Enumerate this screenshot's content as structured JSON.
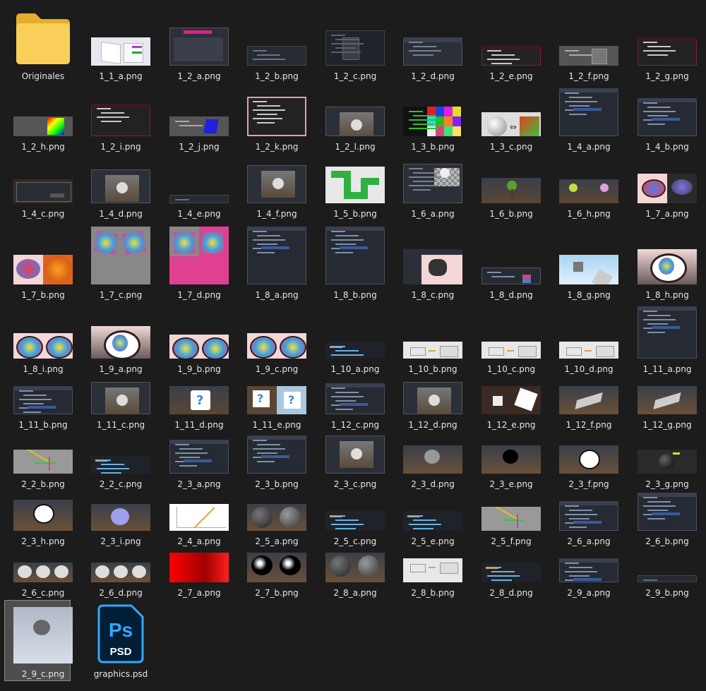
{
  "items": [
    {
      "name": "Originales",
      "kind": "folder"
    },
    {
      "name": "1_1_a.png",
      "kind": "white-diagram"
    },
    {
      "name": "1_2_a.png",
      "kind": "editor-magenta"
    },
    {
      "name": "1_2_b.png",
      "kind": "strip-dark"
    },
    {
      "name": "1_2_c.png",
      "kind": "editor-menu"
    },
    {
      "name": "1_2_d.png",
      "kind": "editor"
    },
    {
      "name": "1_2_e.png",
      "kind": "console-red"
    },
    {
      "name": "1_2_f.png",
      "kind": "gray-panel"
    },
    {
      "name": "1_2_g.png",
      "kind": "console-red"
    },
    {
      "name": "1_2_h.png",
      "kind": "gray-gradient"
    },
    {
      "name": "1_2_i.png",
      "kind": "console-red"
    },
    {
      "name": "1_2_j.png",
      "kind": "gray-blue"
    },
    {
      "name": "1_2_k.png",
      "kind": "console-pink"
    },
    {
      "name": "1_2_l.png",
      "kind": "editor-scene"
    },
    {
      "name": "1_3_b.png",
      "kind": "color-grid"
    },
    {
      "name": "1_3_c.png",
      "kind": "sphere-arrows"
    },
    {
      "name": "1_4_a.png",
      "kind": "tree"
    },
    {
      "name": "1_4_b.png",
      "kind": "tree"
    },
    {
      "name": "1_4_c.png",
      "kind": "dialog"
    },
    {
      "name": "1_4_d.png",
      "kind": "editor-scene"
    },
    {
      "name": "1_4_e.png",
      "kind": "strip-dark"
    },
    {
      "name": "1_4_f.png",
      "kind": "editor-scene"
    },
    {
      "name": "1_5_b.png",
      "kind": "green-pipe"
    },
    {
      "name": "1_6_a.png",
      "kind": "editor-sphere"
    },
    {
      "name": "1_6_b.png",
      "kind": "brown-tree"
    },
    {
      "name": "1_6_h.png",
      "kind": "brown-trees"
    },
    {
      "name": "1_7_a.png",
      "kind": "eyes"
    },
    {
      "name": "1_7_b.png",
      "kind": "eye-orange"
    },
    {
      "name": "1_7_c.png",
      "kind": "eyes-gray"
    },
    {
      "name": "1_7_d.png",
      "kind": "eyes-pink"
    },
    {
      "name": "1_8_a.png",
      "kind": "tree"
    },
    {
      "name": "1_8_b.png",
      "kind": "tree"
    },
    {
      "name": "1_8_c.png",
      "kind": "eye-dark"
    },
    {
      "name": "1_8_d.png",
      "kind": "strip-window"
    },
    {
      "name": "1_8_g.png",
      "kind": "sky-cubes"
    },
    {
      "name": "1_8_h.png",
      "kind": "eye-big"
    },
    {
      "name": "1_8_i.png",
      "kind": "eyes-pair"
    },
    {
      "name": "1_9_a.png",
      "kind": "eye-big"
    },
    {
      "name": "1_9_b.png",
      "kind": "eyes-pair"
    },
    {
      "name": "1_9_c.png",
      "kind": "eyes-pair"
    },
    {
      "name": "1_10_a.png",
      "kind": "code"
    },
    {
      "name": "1_10_b.png",
      "kind": "light-diagram"
    },
    {
      "name": "1_10_c.png",
      "kind": "light-diagram"
    },
    {
      "name": "1_10_d.png",
      "kind": "light-diagram"
    },
    {
      "name": "1_11_a.png",
      "kind": "tree"
    },
    {
      "name": "1_11_b.png",
      "kind": "tree"
    },
    {
      "name": "1_11_c.png",
      "kind": "editor-scene"
    },
    {
      "name": "1_11_d.png",
      "kind": "brown-box"
    },
    {
      "name": "1_11_e.png",
      "kind": "box-pair"
    },
    {
      "name": "1_12_c.png",
      "kind": "tree"
    },
    {
      "name": "1_12_d.png",
      "kind": "editor-scene"
    },
    {
      "name": "1_12_e.png",
      "kind": "cubes"
    },
    {
      "name": "1_12_f.png",
      "kind": "brown-plane"
    },
    {
      "name": "1_12_g.png",
      "kind": "brown-plane"
    },
    {
      "name": "2_2_b.png",
      "kind": "gray-gizmo"
    },
    {
      "name": "2_2_c.png",
      "kind": "code"
    },
    {
      "name": "2_3_a.png",
      "kind": "tree"
    },
    {
      "name": "2_3_b.png",
      "kind": "tree"
    },
    {
      "name": "2_3_c.png",
      "kind": "editor-scene"
    },
    {
      "name": "2_3_d.png",
      "kind": "brown-monkey-gray"
    },
    {
      "name": "2_3_e.png",
      "kind": "brown-monkey-black"
    },
    {
      "name": "2_3_f.png",
      "kind": "brown-monkey-white"
    },
    {
      "name": "2_3_g.png",
      "kind": "dark-ball"
    },
    {
      "name": "2_3_h.png",
      "kind": "brown-monkey-white"
    },
    {
      "name": "2_3_i.png",
      "kind": "brown-monkey-blue"
    },
    {
      "name": "2_4_a.png",
      "kind": "white-graph"
    },
    {
      "name": "2_5_a.png",
      "kind": "brown-spheres"
    },
    {
      "name": "2_5_c.png",
      "kind": "code"
    },
    {
      "name": "2_5_e.png",
      "kind": "code"
    },
    {
      "name": "2_5_f.png",
      "kind": "gray-gizmo"
    },
    {
      "name": "2_6_a.png",
      "kind": "tree"
    },
    {
      "name": "2_6_b.png",
      "kind": "tree"
    },
    {
      "name": "2_6_c.png",
      "kind": "monkeys-row"
    },
    {
      "name": "2_6_d.png",
      "kind": "monkeys-row"
    },
    {
      "name": "2_7_a.png",
      "kind": "red-gradient"
    },
    {
      "name": "2_7_b.png",
      "kind": "monkeys-black"
    },
    {
      "name": "2_8_a.png",
      "kind": "brown-spheres"
    },
    {
      "name": "2_8_b.png",
      "kind": "light-diagram"
    },
    {
      "name": "2_8_d.png",
      "kind": "code"
    },
    {
      "name": "2_9_a.png",
      "kind": "tree"
    },
    {
      "name": "2_9_b.png",
      "kind": "strip-dark"
    },
    {
      "name": "2_9_c.png",
      "kind": "selected-monkey"
    },
    {
      "name": "graphics.psd",
      "kind": "psd"
    }
  ],
  "psd_icon": {
    "ps": "Ps",
    "psd": "PSD"
  },
  "colors": {
    "background": "#1c1c1c",
    "text": "#e6e6e6",
    "selection": "#4e4e4e",
    "folder": "#f5c542"
  }
}
